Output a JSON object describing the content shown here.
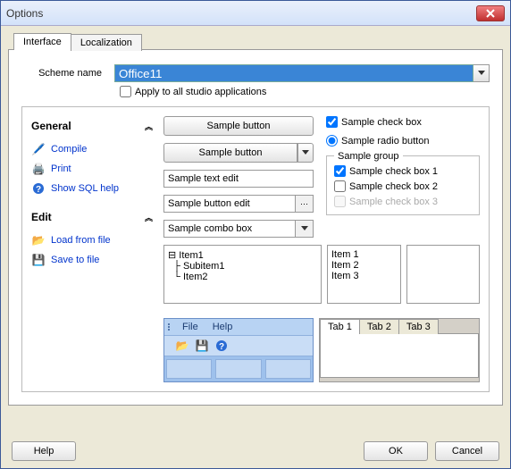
{
  "window": {
    "title": "Options"
  },
  "tabs": {
    "t0": "Interface",
    "t1": "Localization"
  },
  "scheme": {
    "label": "Scheme name",
    "value": "Office11",
    "apply": "Apply to all studio applications"
  },
  "sidebar": {
    "group1": "General",
    "group2": "Edit",
    "items": {
      "compile": "Compile",
      "print": "Print",
      "sqlhelp": "Show SQL help",
      "load": "Load from file",
      "save": "Save to file"
    }
  },
  "samples": {
    "btn1": "Sample button",
    "btn2": "Sample button",
    "textedit": "Sample text edit",
    "btnedit": "Sample button edit",
    "combo": "Sample combo box",
    "check": "Sample check box",
    "radio": "Sample radio button",
    "group_title": "Sample group",
    "gcheck1": "Sample check box 1",
    "gcheck2": "Sample check box 2",
    "gcheck3": "Sample check box 3"
  },
  "tree": {
    "i1": "Item1",
    "i1a": "Subitem1",
    "i2": "Item2"
  },
  "list": {
    "l1": "Item 1",
    "l2": "Item 2",
    "l3": "Item 3"
  },
  "menu": {
    "file": "File",
    "help": "Help"
  },
  "tabctrl": {
    "t1": "Tab 1",
    "t2": "Tab 2",
    "t3": "Tab 3"
  },
  "buttons": {
    "help": "Help",
    "ok": "OK",
    "cancel": "Cancel"
  }
}
